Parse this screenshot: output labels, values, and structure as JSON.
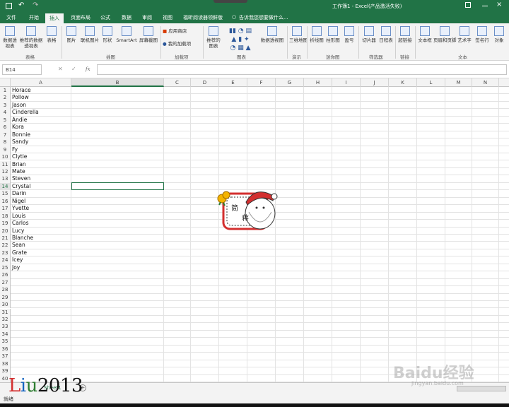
{
  "titlebar": {
    "title": "工作簿1 - Excel(产品激活失败)"
  },
  "tabs": [
    "文件",
    "开始",
    "插入",
    "页面布局",
    "公式",
    "数据",
    "审阅",
    "视图",
    "福昕阅读器领鲜版"
  ],
  "active_tab": "插入",
  "tell_me": "告诉我您想要做什么...",
  "ribbon": {
    "buttons": [
      "数据透视表",
      "推荐的数据透视表",
      "表格",
      "图片",
      "联机图片",
      "形状",
      "SmartArt",
      "屏幕截图",
      "应用商店",
      "我的加载项",
      "推荐的图表",
      "数据透视图",
      "三维地图",
      "折线图",
      "柱形图",
      "盈亏",
      "切片器",
      "日程表",
      "超链接",
      "文本框",
      "页眉和页脚",
      "艺术字",
      "签名行",
      "对象"
    ],
    "groups": [
      "表格",
      "插图",
      "加载项",
      "图表",
      "演示",
      "迷你图",
      "筛选器",
      "链接",
      "文本"
    ]
  },
  "formula_bar": {
    "name_box": "B14",
    "fx": "fx",
    "value": ""
  },
  "columns": [
    "A",
    "B",
    "C",
    "D",
    "E",
    "F",
    "G",
    "H",
    "I",
    "J",
    "K",
    "L",
    "M",
    "N"
  ],
  "rows": [
    "Horace",
    "Pollow",
    "Jason",
    "Cinderella",
    "Andie",
    "Kora",
    "Bonnie",
    "Sandy",
    "Fy",
    "Clytie",
    "Brian",
    "Mate",
    "Steven",
    "Crystal",
    "Darin",
    "Nigel",
    "Yvette",
    "Louis",
    "Carlos",
    "Lucy",
    "Blanche",
    "Sean",
    "Grate",
    "Icey",
    "Joy"
  ],
  "row_count": 40,
  "sticker": {
    "text1": "简",
    "text2": "蒋"
  },
  "sheet": {
    "tab": "Sheet1"
  },
  "status": {
    "text": "就绪"
  },
  "watermark": {
    "author": "Liu2013",
    "site": "Baidu经验",
    "url": "jingyan.baidu.com"
  }
}
